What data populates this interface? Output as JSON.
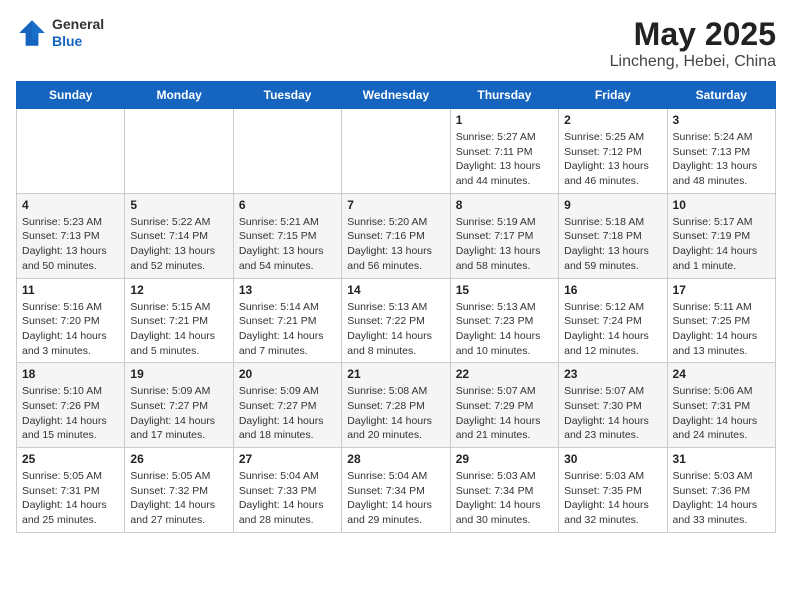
{
  "header": {
    "logo_line1": "General",
    "logo_line2": "Blue",
    "title": "May 2025",
    "subtitle": "Lincheng, Hebei, China"
  },
  "calendar": {
    "days_of_week": [
      "Sunday",
      "Monday",
      "Tuesday",
      "Wednesday",
      "Thursday",
      "Friday",
      "Saturday"
    ],
    "weeks": [
      [
        {
          "day": "",
          "info": ""
        },
        {
          "day": "",
          "info": ""
        },
        {
          "day": "",
          "info": ""
        },
        {
          "day": "",
          "info": ""
        },
        {
          "day": "1",
          "info": "Sunrise: 5:27 AM\nSunset: 7:11 PM\nDaylight: 13 hours\nand 44 minutes."
        },
        {
          "day": "2",
          "info": "Sunrise: 5:25 AM\nSunset: 7:12 PM\nDaylight: 13 hours\nand 46 minutes."
        },
        {
          "day": "3",
          "info": "Sunrise: 5:24 AM\nSunset: 7:13 PM\nDaylight: 13 hours\nand 48 minutes."
        }
      ],
      [
        {
          "day": "4",
          "info": "Sunrise: 5:23 AM\nSunset: 7:13 PM\nDaylight: 13 hours\nand 50 minutes."
        },
        {
          "day": "5",
          "info": "Sunrise: 5:22 AM\nSunset: 7:14 PM\nDaylight: 13 hours\nand 52 minutes."
        },
        {
          "day": "6",
          "info": "Sunrise: 5:21 AM\nSunset: 7:15 PM\nDaylight: 13 hours\nand 54 minutes."
        },
        {
          "day": "7",
          "info": "Sunrise: 5:20 AM\nSunset: 7:16 PM\nDaylight: 13 hours\nand 56 minutes."
        },
        {
          "day": "8",
          "info": "Sunrise: 5:19 AM\nSunset: 7:17 PM\nDaylight: 13 hours\nand 58 minutes."
        },
        {
          "day": "9",
          "info": "Sunrise: 5:18 AM\nSunset: 7:18 PM\nDaylight: 13 hours\nand 59 minutes."
        },
        {
          "day": "10",
          "info": "Sunrise: 5:17 AM\nSunset: 7:19 PM\nDaylight: 14 hours\nand 1 minute."
        }
      ],
      [
        {
          "day": "11",
          "info": "Sunrise: 5:16 AM\nSunset: 7:20 PM\nDaylight: 14 hours\nand 3 minutes."
        },
        {
          "day": "12",
          "info": "Sunrise: 5:15 AM\nSunset: 7:21 PM\nDaylight: 14 hours\nand 5 minutes."
        },
        {
          "day": "13",
          "info": "Sunrise: 5:14 AM\nSunset: 7:21 PM\nDaylight: 14 hours\nand 7 minutes."
        },
        {
          "day": "14",
          "info": "Sunrise: 5:13 AM\nSunset: 7:22 PM\nDaylight: 14 hours\nand 8 minutes."
        },
        {
          "day": "15",
          "info": "Sunrise: 5:13 AM\nSunset: 7:23 PM\nDaylight: 14 hours\nand 10 minutes."
        },
        {
          "day": "16",
          "info": "Sunrise: 5:12 AM\nSunset: 7:24 PM\nDaylight: 14 hours\nand 12 minutes."
        },
        {
          "day": "17",
          "info": "Sunrise: 5:11 AM\nSunset: 7:25 PM\nDaylight: 14 hours\nand 13 minutes."
        }
      ],
      [
        {
          "day": "18",
          "info": "Sunrise: 5:10 AM\nSunset: 7:26 PM\nDaylight: 14 hours\nand 15 minutes."
        },
        {
          "day": "19",
          "info": "Sunrise: 5:09 AM\nSunset: 7:27 PM\nDaylight: 14 hours\nand 17 minutes."
        },
        {
          "day": "20",
          "info": "Sunrise: 5:09 AM\nSunset: 7:27 PM\nDaylight: 14 hours\nand 18 minutes."
        },
        {
          "day": "21",
          "info": "Sunrise: 5:08 AM\nSunset: 7:28 PM\nDaylight: 14 hours\nand 20 minutes."
        },
        {
          "day": "22",
          "info": "Sunrise: 5:07 AM\nSunset: 7:29 PM\nDaylight: 14 hours\nand 21 minutes."
        },
        {
          "day": "23",
          "info": "Sunrise: 5:07 AM\nSunset: 7:30 PM\nDaylight: 14 hours\nand 23 minutes."
        },
        {
          "day": "24",
          "info": "Sunrise: 5:06 AM\nSunset: 7:31 PM\nDaylight: 14 hours\nand 24 minutes."
        }
      ],
      [
        {
          "day": "25",
          "info": "Sunrise: 5:05 AM\nSunset: 7:31 PM\nDaylight: 14 hours\nand 25 minutes."
        },
        {
          "day": "26",
          "info": "Sunrise: 5:05 AM\nSunset: 7:32 PM\nDaylight: 14 hours\nand 27 minutes."
        },
        {
          "day": "27",
          "info": "Sunrise: 5:04 AM\nSunset: 7:33 PM\nDaylight: 14 hours\nand 28 minutes."
        },
        {
          "day": "28",
          "info": "Sunrise: 5:04 AM\nSunset: 7:34 PM\nDaylight: 14 hours\nand 29 minutes."
        },
        {
          "day": "29",
          "info": "Sunrise: 5:03 AM\nSunset: 7:34 PM\nDaylight: 14 hours\nand 30 minutes."
        },
        {
          "day": "30",
          "info": "Sunrise: 5:03 AM\nSunset: 7:35 PM\nDaylight: 14 hours\nand 32 minutes."
        },
        {
          "day": "31",
          "info": "Sunrise: 5:03 AM\nSunset: 7:36 PM\nDaylight: 14 hours\nand 33 minutes."
        }
      ]
    ]
  }
}
